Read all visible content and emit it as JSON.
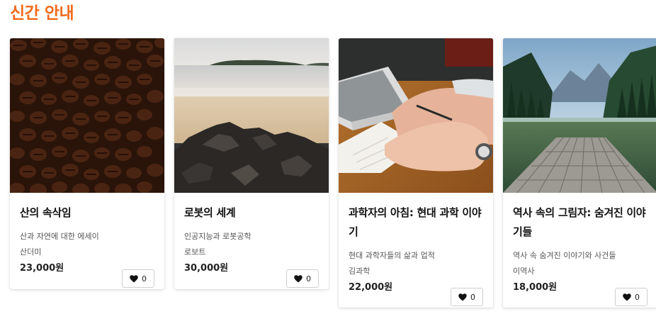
{
  "section": {
    "title": "신간 안내",
    "accent_color": "#f06a1a"
  },
  "books": [
    {
      "title": "산의 속삭임",
      "subtitle": "산과 자연에 대한 에세이",
      "author": "산더미",
      "price": "23,000원",
      "likes": "0",
      "image": "coffee-beans-photo"
    },
    {
      "title": "로봇의 세계",
      "subtitle": "인공지능과 로봇공학",
      "author": "로보트",
      "price": "30,000원",
      "likes": "0",
      "image": "beach-rocks-photo"
    },
    {
      "title": "과학자의 아침: 현대 과학 이야기",
      "subtitle": "현대 과학자들의 삶과 업적",
      "author": "김과학",
      "price": "22,000원",
      "likes": "0",
      "image": "writing-desk-photo"
    },
    {
      "title": "역사 속의 그림자: 숨겨진 이야기들",
      "subtitle": "역사 속 숨겨진 이야기와 사건들",
      "author": "이역사",
      "price": "18,000원",
      "likes": "0",
      "image": "lake-dock-photo"
    }
  ],
  "icons": {
    "like": "heart-icon"
  }
}
